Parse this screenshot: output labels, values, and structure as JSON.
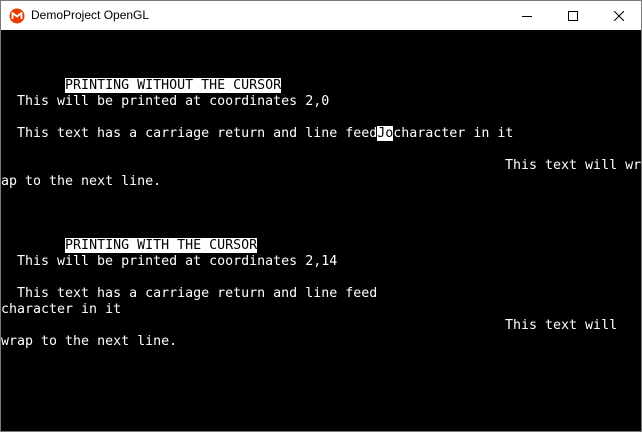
{
  "window": {
    "title": "DemoProject OpenGL",
    "controls": {
      "minimize_icon": "minimize-icon",
      "maximize_icon": "maximize-icon",
      "close_icon": "close-icon"
    }
  },
  "console": {
    "heading_without_cursor": "PRINTING WITHOUT THE CURSOR",
    "coords_2_0": "This will be printed at coordinates 2,0",
    "crlf_line1_before": "This text has a carriage return and line feed",
    "crlf_line1_cursor": "Jo",
    "crlf_line1_after": "character in it",
    "wrap1_line1": "This text will wr",
    "wrap1_line2": "ap to the next line.",
    "heading_with_cursor": "PRINTING WITH THE CURSOR",
    "coords_2_14": "This will be printed at coordinates 2,14",
    "crlf2_line1": "This text has a carriage return and line feed",
    "crlf2_line2": "character in it",
    "wrap2_line1": "This text will",
    "wrap2_line2": "wrap to the next line."
  },
  "colors": {
    "background": "#000000",
    "foreground": "#ffffff",
    "titlebar": "#ffffff"
  }
}
